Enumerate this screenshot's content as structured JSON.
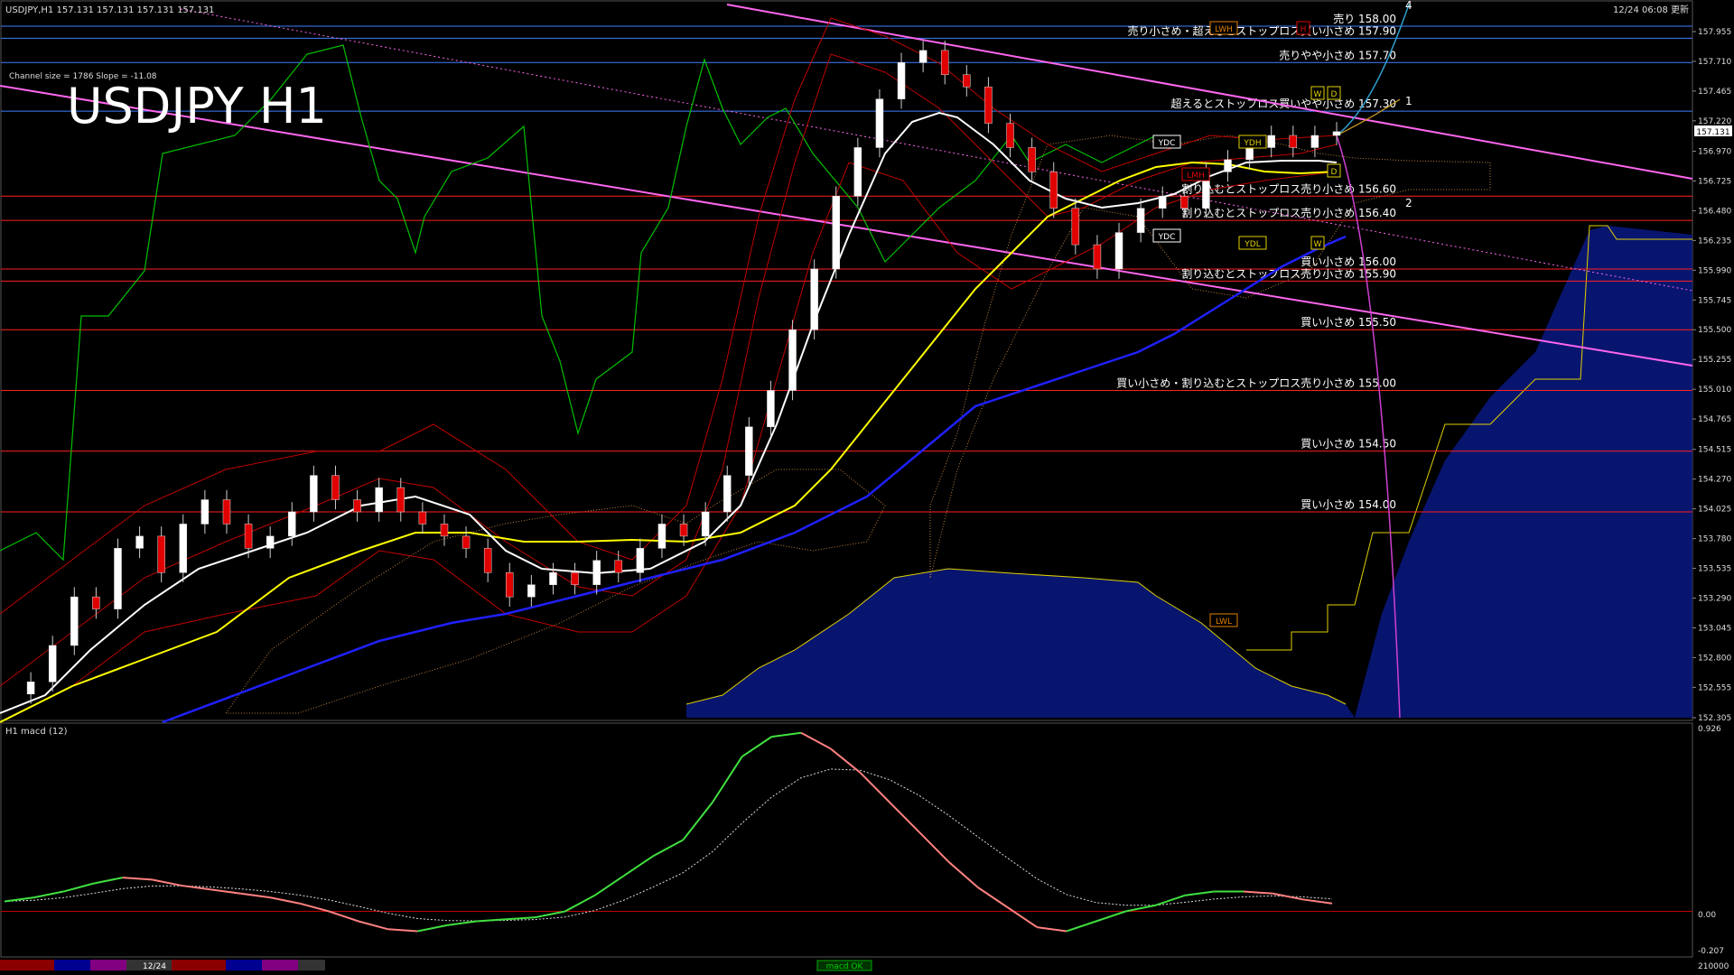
{
  "header": {
    "symbol_info": "USDJPY,H1  157.131 157.131 157.131 157.131",
    "update_text": "12/24 06:08 更新"
  },
  "main": {
    "title": "USDJPY H1",
    "channel_info": "Channel size = 1786 Slope = -11.08",
    "current_price_tag": "157.131",
    "label_1": "1",
    "label_2": "2",
    "label_4": "4"
  },
  "price_axis": [
    "157.955",
    "157.710",
    "157.465",
    "157.220",
    "156.970",
    "156.725",
    "156.480",
    "156.235",
    "155.990",
    "155.745",
    "155.500",
    "155.255",
    "155.010",
    "154.765",
    "154.515",
    "154.270",
    "154.025",
    "153.780",
    "153.535",
    "153.290",
    "153.045",
    "152.800",
    "152.555",
    "152.305"
  ],
  "levels": [
    {
      "price": 158.0,
      "text": "売り 158.00",
      "color": "#3f7fff"
    },
    {
      "price": 157.9,
      "text": "売り小さめ・超えるとストップロス買い小さめ 157.90",
      "color": "#3f7fff"
    },
    {
      "price": 157.7,
      "text": "売りやや小さめ 157.70",
      "color": "#3f7fff"
    },
    {
      "price": 157.3,
      "text": "超えるとストップロス買いやや小さめ 157.30",
      "color": "#3f7fff"
    },
    {
      "price": 156.6,
      "text": "割り込むとストップロス売り小さめ 156.60",
      "color": "#ff2020"
    },
    {
      "price": 156.4,
      "text": "割り込むとストップロス売り小さめ 156.40",
      "color": "#ff2020"
    },
    {
      "price": 156.0,
      "text": "買い小さめ 156.00",
      "color": "#ff2020"
    },
    {
      "price": 155.9,
      "text": "割り込むとストップロス売り小さめ 155.90",
      "color": "#ff2020"
    },
    {
      "price": 155.5,
      "text": "買い小さめ 155.50",
      "color": "#ff2020"
    },
    {
      "price": 155.0,
      "text": "買い小さめ・割り込むとストップロス売り小さめ 155.00",
      "color": "#ff2020"
    },
    {
      "price": 154.5,
      "text": "買い小さめ 154.50",
      "color": "#ff2020"
    },
    {
      "price": 154.0,
      "text": "買い小さめ 154.00",
      "color": "#ff2020"
    }
  ],
  "boxes": {
    "lwh": "LWH",
    "ydh": "YDH",
    "ydc_top": "YDC",
    "lmh": "LMH",
    "ydc_bottom": "YDC",
    "ydl": "YDL",
    "lwl": "LWL",
    "w_top": "W",
    "d_top": "D",
    "d_mid": "D",
    "w_mid": "W",
    "h_top": "H"
  },
  "macd_panel": {
    "label": "H1  macd (12)",
    "axis": [
      "0.926",
      "0.00",
      "-0.207"
    ]
  },
  "bottom_bar": {
    "date": "12/24",
    "right_value": "210000",
    "center_label": "macd OK"
  },
  "colors": {
    "buy_level": "#3f7fff",
    "sell_level": "#ff2020",
    "channel": "#ff66ee",
    "ma_white": "#ffffff",
    "ma_yellow": "#ffff00",
    "ma_blue": "#2020ff",
    "chikou": "#00c000",
    "macd": "#40e040",
    "macd_neg": "#ff8080"
  },
  "chart_data": {
    "type": "line",
    "symbol": "USDJPY",
    "timeframe": "H1",
    "ylim": [
      152.305,
      158.2
    ],
    "close_series": [
      152.5,
      152.6,
      152.9,
      153.3,
      153.2,
      153.7,
      153.8,
      153.5,
      153.9,
      154.1,
      153.9,
      153.7,
      153.8,
      154.0,
      154.3,
      154.1,
      154.0,
      154.2,
      154.0,
      153.9,
      153.8,
      153.7,
      153.5,
      153.3,
      153.4,
      153.5,
      153.4,
      153.6,
      153.5,
      153.7,
      153.9,
      153.8,
      154.0,
      154.3,
      154.7,
      155.0,
      155.5,
      156.0,
      156.6,
      157.0,
      157.4,
      157.7,
      157.8,
      157.6,
      157.5,
      157.2,
      157.0,
      156.8,
      156.5,
      156.2,
      156.0,
      156.3,
      156.5,
      156.6,
      156.5,
      156.8,
      156.9,
      157.0,
      157.1,
      157.0,
      157.1,
      157.131
    ],
    "macd_values": [
      0.05,
      0.07,
      0.1,
      0.14,
      0.17,
      0.16,
      0.13,
      0.11,
      0.09,
      0.07,
      0.04,
      0.0,
      -0.05,
      -0.09,
      -0.1,
      -0.07,
      -0.05,
      -0.04,
      -0.03,
      0.0,
      0.08,
      0.18,
      0.28,
      0.36,
      0.55,
      0.78,
      0.88,
      0.9,
      0.82,
      0.7,
      0.55,
      0.4,
      0.25,
      0.12,
      0.02,
      -0.08,
      -0.1,
      -0.05,
      0.0,
      0.03,
      0.08,
      0.1,
      0.1,
      0.09,
      0.06,
      0.04
    ]
  }
}
